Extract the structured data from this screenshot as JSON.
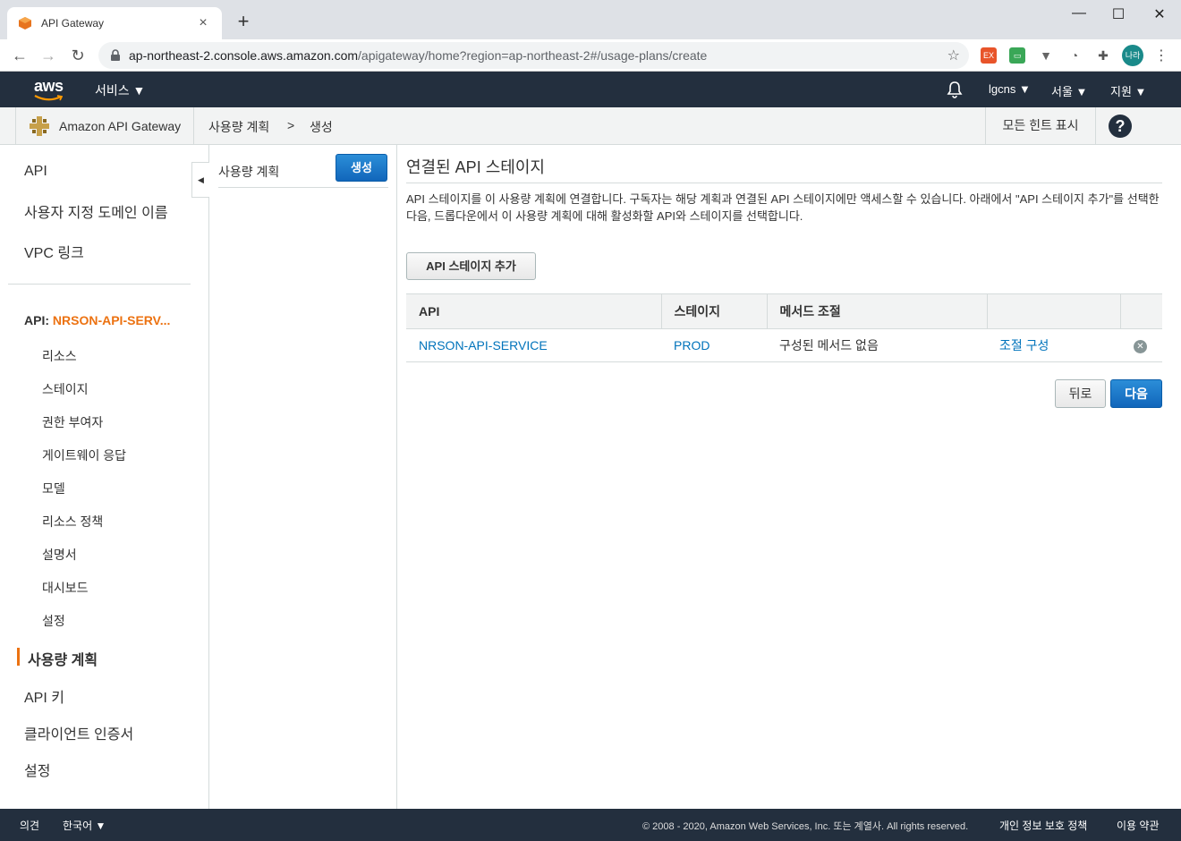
{
  "browser": {
    "tab_title": "API Gateway",
    "tab_close": "×",
    "new_tab": "+",
    "url_host": "ap-northeast-2.console.aws.amazon.com",
    "url_path": "/apigateway/home?region=ap-northeast-2#/usage-plans/create",
    "profile_label": "나라",
    "window": {
      "minimize": "—",
      "maximize": "☐",
      "close": "✕"
    }
  },
  "aws_nav": {
    "logo": "aws",
    "services": "서비스 ▼",
    "account": "lgcns ▼",
    "region": "서울 ▼",
    "support": "지원 ▼"
  },
  "breadcrumb": {
    "service": "Amazon API Gateway",
    "crumb1": "사용량 계획",
    "sep": ">",
    "crumb2": "생성",
    "hints": "모든 힌트 표시",
    "help": "?"
  },
  "sidebar": {
    "top_items": [
      "API",
      "사용자 지정 도메인 이름",
      "VPC 링크"
    ],
    "api_prefix": "API: ",
    "api_name": "NRSON-API-SERV...",
    "sub_items": [
      "리소스",
      "스테이지",
      "권한 부여자",
      "게이트웨이 응답",
      "모델",
      "리소스 정책",
      "설명서",
      "대시보드",
      "설정"
    ],
    "bottom_items": [
      "사용량 계획",
      "API 키",
      "클라이언트 인증서",
      "설정"
    ],
    "collapse": "◀"
  },
  "midpanel": {
    "title": "사용량 계획",
    "create_label": "생성"
  },
  "main": {
    "heading": "연결된 API 스테이지",
    "description": "API 스테이지를 이 사용량 계획에 연결합니다. 구독자는 해당 계획과 연결된 API 스테이지에만 액세스할 수 있습니다. 아래에서 \"API 스테이지 추가\"를 선택한 다음, 드롭다운에서 이 사용량 계획에 대해 활성화할 API와 스테이지를 선택합니다.",
    "add_stage_label": "API 스테이지 추가",
    "table": {
      "headers": [
        "API",
        "스테이지",
        "메서드 조절",
        "",
        ""
      ],
      "rows": [
        {
          "api": "NRSON-API-SERVICE",
          "stage": "PROD",
          "method_throttle": "구성된 메서드 없음",
          "configure": "조절 구성",
          "remove": "✕"
        }
      ]
    },
    "back_label": "뒤로",
    "next_label": "다음"
  },
  "footer": {
    "feedback": "의견",
    "language": "한국어 ▼",
    "copyright": "© 2008 - 2020, Amazon Web Services, Inc. 또는 계열사. All rights reserved.",
    "privacy": "개인 정보 보호 정책",
    "terms": "이용 약관"
  }
}
